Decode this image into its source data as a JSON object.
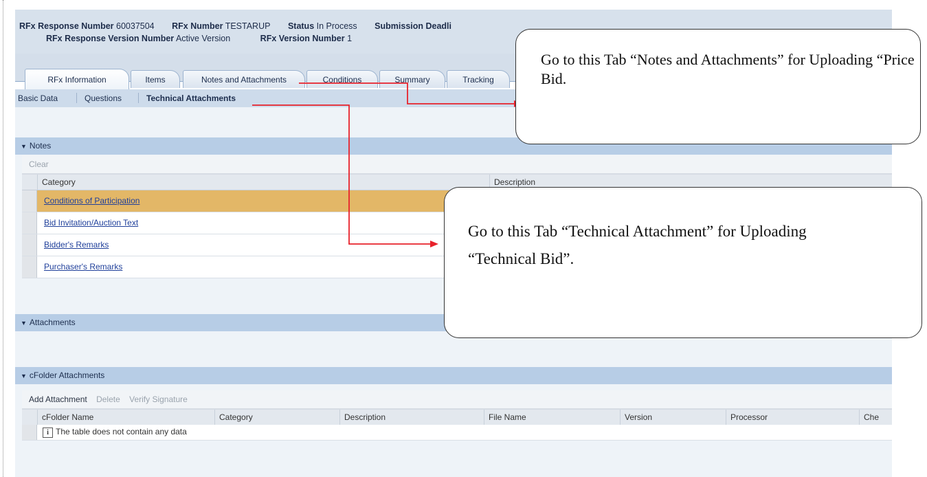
{
  "header": {
    "rfx_response_number_label": "RFx Response Number",
    "rfx_response_number_value": "60037504",
    "rfx_number_label": "RFx Number",
    "rfx_number_value": "TESTARUP",
    "status_label": "Status",
    "status_value": "In Process",
    "submission_deadline_label": "Submission Deadli",
    "response_version_label": "RFx Response Version Number",
    "response_version_value": "Active Version",
    "rfx_version_label": "RFx Version Number",
    "rfx_version_value": "1"
  },
  "tabs": [
    "RFx Information",
    "Items",
    "Notes and Attachments",
    "Conditions",
    "Summary",
    "Tracking"
  ],
  "active_tab": "RFx Information",
  "subnav": [
    "Basic Data",
    "Questions",
    "Technical Attachments"
  ],
  "notes": {
    "title": "Notes",
    "clear_button": "Clear",
    "columns": [
      "Category",
      "Description"
    ],
    "rows": [
      "Conditions of Participation",
      "Bid Invitation/Auction Text",
      "Bidder's Remarks",
      "Purchaser's Remarks"
    ]
  },
  "attachments": {
    "title": "Attachments"
  },
  "cfolder": {
    "title": "cFolder Attachments",
    "buttons": [
      "Add Attachment",
      "Delete",
      "Verify Signature"
    ],
    "columns": [
      "cFolder Name",
      "Category",
      "Description",
      "File Name",
      "Version",
      "Processor",
      "Che"
    ],
    "empty_message": "The table does not contain any data"
  },
  "callouts": {
    "notes_tab": "Go to this Tab “Notes and Attachments” for Uploading “Price Bid.",
    "technical_tab_line1": "Go to this Tab “Technical Attachment” for Uploading",
    "technical_tab_line2": "“Technical Bid”."
  },
  "colors": {
    "arrow": "#e8222b",
    "selected_row": "#e3b767",
    "section_header": "#b7cde6"
  }
}
